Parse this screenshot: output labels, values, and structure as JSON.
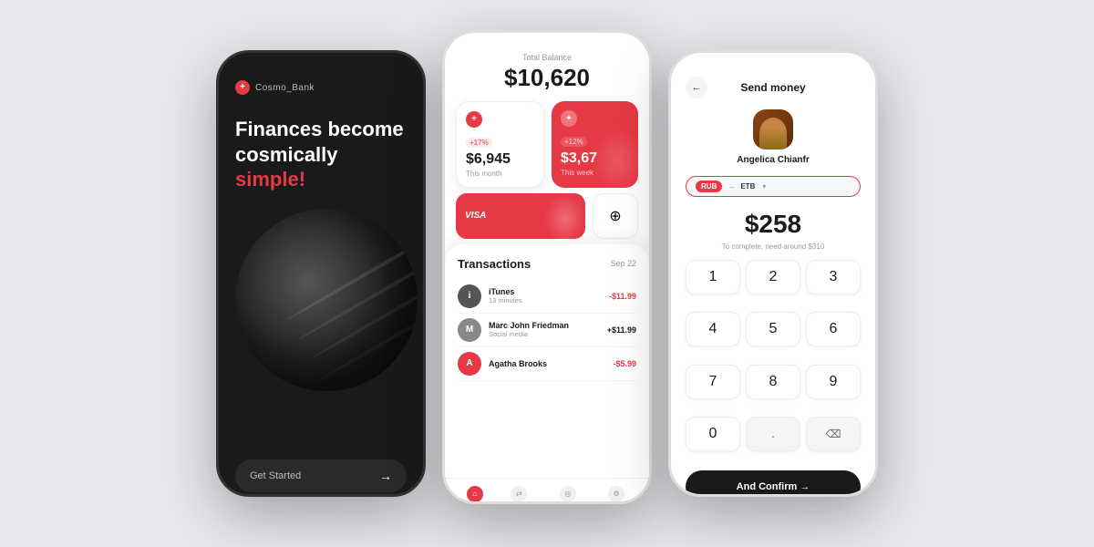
{
  "background": "#e8e8ec",
  "phone1": {
    "brand": "Cosmo_Bank",
    "headline_line1": "Finances become",
    "headline_line2": "cosmically",
    "headline_highlight": "simple!",
    "cta_label": "Get Started",
    "cta_arrow": "→"
  },
  "phone2": {
    "balance_label": "Total Balance",
    "balance_amount": "$10,620",
    "card1": {
      "badge": "+17%",
      "amount": "$6,945",
      "sublabel": "This month"
    },
    "card2": {
      "badge": "+12%",
      "amount": "$3,67",
      "sublabel": "This week"
    },
    "visa_label": "VISA",
    "transactions": {
      "title": "Transactions",
      "date": "Sep 22",
      "items": [
        {
          "name": "iTunes",
          "sub": "13 minutes",
          "amount": "-$11.99",
          "negative": true,
          "letter": "i"
        },
        {
          "name": "Marc John Friedman",
          "sub": "Social media",
          "amount": "+$11.99",
          "negative": false,
          "letter": "M"
        },
        {
          "name": "Agatha Brooks",
          "sub": "",
          "amount": "-$5.99",
          "negative": true,
          "letter": "A"
        }
      ]
    },
    "nav_items": [
      {
        "label": "Home",
        "active": true,
        "icon": "⌂"
      },
      {
        "label": "Transfer",
        "active": false,
        "icon": "⇄"
      },
      {
        "label": "Analytics",
        "active": false,
        "icon": "◎"
      },
      {
        "label": "Settings",
        "active": false,
        "icon": "⚙"
      }
    ]
  },
  "phone3": {
    "back_icon": "←",
    "title": "Send money",
    "recipient_name": "Angelica Chianfr",
    "currency_from": "RUB",
    "currency_to": "ETB",
    "amount": "$258",
    "amount_note": "To complete, need around $310",
    "numpad": [
      "1",
      "2",
      "3",
      "4",
      "5",
      "6",
      "7",
      "8",
      "9",
      "0",
      ".",
      "⌫"
    ],
    "confirm_label": "And Confirm →"
  }
}
